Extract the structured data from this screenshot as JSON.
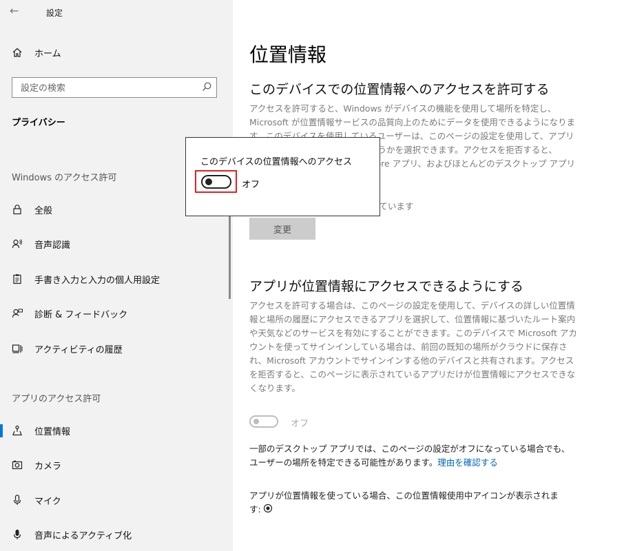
{
  "window": {
    "back_glyph": "←",
    "title": "設定"
  },
  "sidebar": {
    "home": {
      "label": "ホーム",
      "icon": "home-icon"
    },
    "search": {
      "placeholder": "設定の検索",
      "icon": "search-icon"
    },
    "category_title": "プライバシー",
    "sections": [
      {
        "title": "Windows のアクセス許可",
        "items": [
          {
            "label": "全般",
            "icon": "lock-icon"
          },
          {
            "label": "音声認識",
            "icon": "speech-icon"
          },
          {
            "label": "手書き入力と入力の個人用設定",
            "icon": "clipboard-icon"
          },
          {
            "label": "診断 & フィードバック",
            "icon": "feedback-icon"
          },
          {
            "label": "アクティビティの履歴",
            "icon": "activity-icon"
          }
        ]
      },
      {
        "title": "アプリのアクセス許可",
        "items": [
          {
            "label": "位置情報",
            "icon": "location-icon",
            "selected": true
          },
          {
            "label": "カメラ",
            "icon": "camera-icon"
          },
          {
            "label": "マイク",
            "icon": "microphone-icon"
          },
          {
            "label": "音声によるアクティブ化",
            "icon": "voice-activation-icon"
          }
        ]
      }
    ]
  },
  "main": {
    "title": "位置情報",
    "device_section": {
      "heading": "このデバイスでの位置情報へのアクセスを許可する",
      "description": "アクセスを許可すると、Windows がデバイスの機能を使用して場所を特定し、Microsoft が位置情報サービスの品質向上のためにデータを使用できるようになります。このデバイスを使用しているユーザーは、このページの設定を使用して、アプリが位置情報にアクセスできるかどうかを選択できます。アクセスを拒否すると、Windows の機能、Microsoft Store アプリ、およびほとんどのデスクトップ アプリへの位置情報",
      "status_tail": "なっています",
      "change_button": "変更"
    },
    "app_section": {
      "heading": "アプリが位置情報にアクセスできるようにする",
      "description": "アクセスを許可する場合は、このページの設定を使用して、デバイスの詳しい位置情報と場所の履歴にアクセスできるアプリを選択して、位置情報に基づいたルート案内や天気などのサービスを有効にすることができます。このデバイスで Microsoft アカウントを使ってサインインしている場合は、前回の既知の場所がクラウドに保存され、Microsoft アカウントでサインインする他のデバイスと共有されます。アクセスを拒否すると、このページに表示されているアプリだけが位置情報にアクセスできなくなります。",
      "toggle_state": "オフ",
      "desktop_note": "一部のデスクトップ アプリでは、このページの設定がオフになっている場合でも、ユーザーの場所を特定できる可能性があります。",
      "desktop_link": "理由を確認する",
      "icon_note": "アプリが位置情報を使っている場合、この位置情報使用中アイコンが表示されます:"
    }
  },
  "popup": {
    "label": "このデバイスの位置情報へのアクセス",
    "toggle_state": "オフ",
    "highlight_color": "#e02020"
  },
  "colors": {
    "accent": "#0078d7",
    "link": "#0067b8",
    "sidebar_bg": "#f2f2f2"
  }
}
